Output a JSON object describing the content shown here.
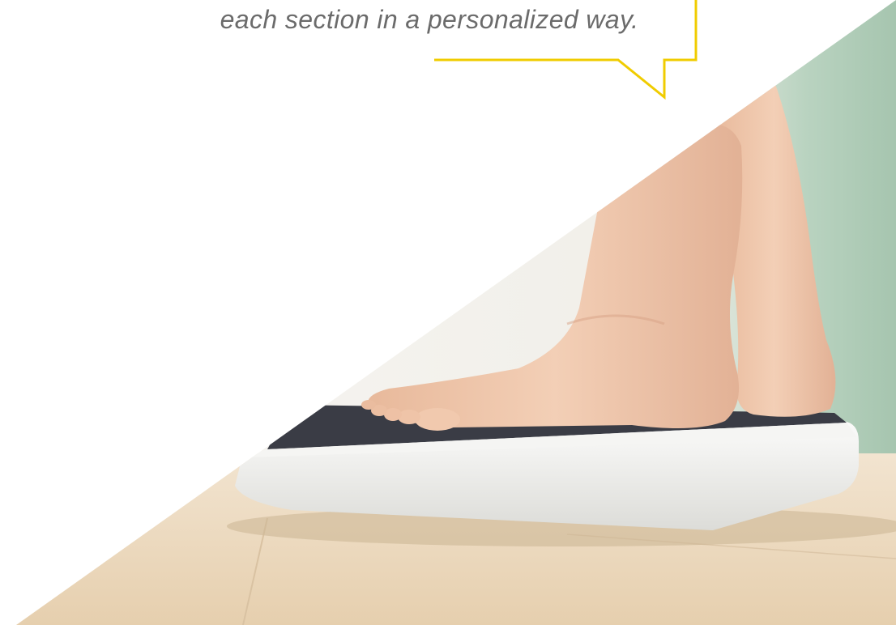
{
  "callout": {
    "text": "each section in a personalized way.",
    "border_color": "#f0cc00"
  },
  "photo": {
    "subject": "feet-on-bathroom-scale",
    "colors": {
      "floor": "#ecd9bf",
      "wall_green": "#a9c7b2",
      "scale_body": "#f3f3f1",
      "scale_top": "#3a3c45",
      "skin": "#edc3a6"
    }
  }
}
